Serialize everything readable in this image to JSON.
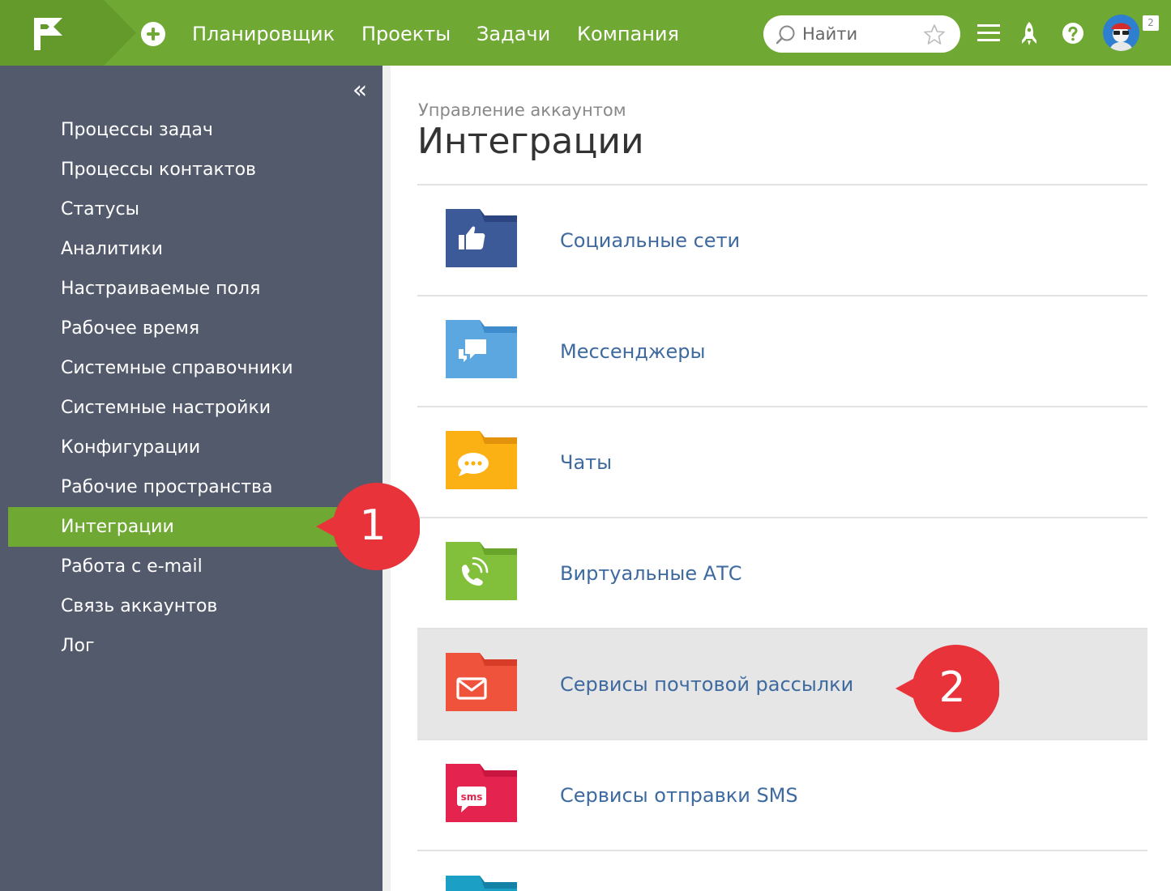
{
  "header": {
    "nav": [
      "Планировщик",
      "Проекты",
      "Задачи",
      "Компания"
    ],
    "search_placeholder": "Найти",
    "notifications_count": "2",
    "icons": [
      "logo-flag-icon",
      "plus-icon",
      "search-icon",
      "star-icon",
      "menu-icon",
      "rocket-icon",
      "help-icon"
    ]
  },
  "sidebar": {
    "collapse_label": "«",
    "items": [
      "Процессы задач",
      "Процессы контактов",
      "Статусы",
      "Аналитики",
      "Настраиваемые поля",
      "Рабочее время",
      "Системные справочники",
      "Системные настройки",
      "Конфигурации",
      "Рабочие пространства",
      "Интеграции",
      "Работа с e-mail",
      "Связь аккаунтов",
      "Лог"
    ],
    "active_index": 10
  },
  "main": {
    "breadcrumb": "Управление аккаунтом",
    "title": "Интеграции",
    "integrations": [
      {
        "label": "Социальные сети",
        "icon": "thumbs-up-icon",
        "color": "#3d5a98"
      },
      {
        "label": "Мессенджеры",
        "icon": "chat-bubbles-icon",
        "color": "#5da7e0"
      },
      {
        "label": "Чаты",
        "icon": "speech-bubble-icon",
        "color": "#fbb114"
      },
      {
        "label": "Виртуальные АТС",
        "icon": "phone-icon",
        "color": "#82c03b"
      },
      {
        "label": "Сервисы почтовой рассылки",
        "icon": "envelope-icon",
        "color": "#f0533c"
      },
      {
        "label": "Сервисы отправки SMS",
        "icon": "sms-bubble-icon",
        "sms_text": "sms",
        "color": "#e4234e"
      }
    ]
  },
  "callouts": [
    "1",
    "2"
  ],
  "colors": {
    "brand_green": "#6fa833",
    "sidebar_bg": "#535a6c",
    "link_blue": "#3e6aa0",
    "callout_red": "#e8333a"
  }
}
